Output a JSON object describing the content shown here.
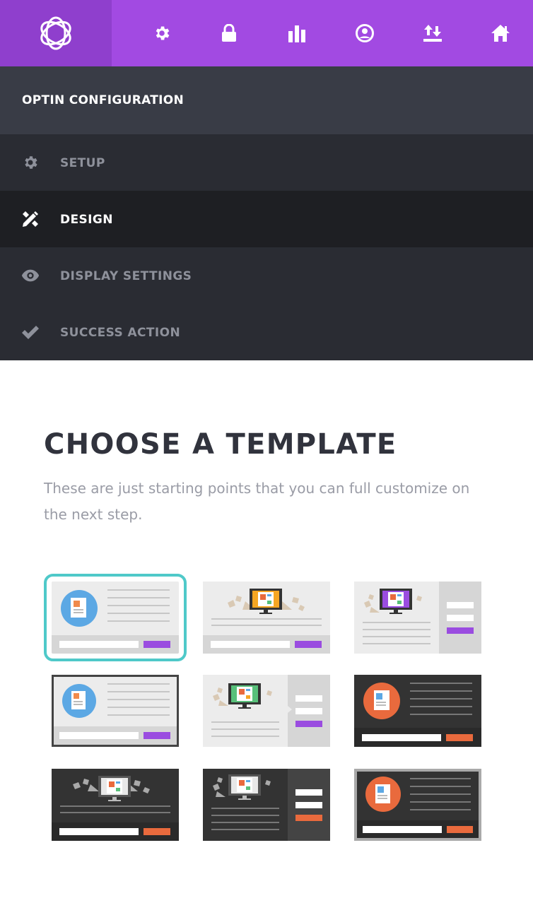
{
  "header": {
    "logo_icon": "bloom-logo-icon",
    "icons": [
      "gear-icon",
      "lock-icon",
      "stats-icon",
      "profile-icon",
      "import-export-icon",
      "home-icon"
    ],
    "bg_color": "#a24ae2"
  },
  "sidebar": {
    "section_title": "OPTIN CONFIGURATION",
    "items": [
      {
        "label": "SETUP",
        "icon": "gear-icon",
        "active": false
      },
      {
        "label": "DESIGN",
        "icon": "design-tools-icon",
        "active": true
      },
      {
        "label": "DISPLAY SETTINGS",
        "icon": "eye-icon",
        "active": false
      },
      {
        "label": "SUCCESS ACTION",
        "icon": "checkmark-icon",
        "active": false
      }
    ]
  },
  "main": {
    "title": "CHOOSE A TEMPLATE",
    "subtitle": "These are just starting points that you can full customize on the next step.",
    "selected_index": 0,
    "accent_color": "#9a4ce0",
    "highlight_color": "#4fc9c9"
  }
}
